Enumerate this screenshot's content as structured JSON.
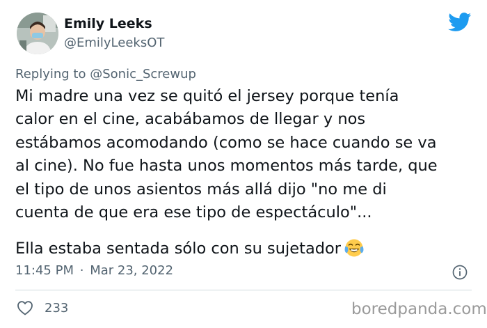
{
  "author": {
    "display_name": "Emily Leeks",
    "handle": "@EmilyLeeksOT",
    "avatar_icon": "profile-photo"
  },
  "reply": {
    "prefix": "Replying to",
    "mention": "@Sonic_Screwup"
  },
  "tweet": {
    "lines": [
      "Mi madre una vez se quitó el jersey porque tenía",
      "calor en el cine, acabábamos de llegar y nos",
      "estábamos acomodando (como se hace cuando se va",
      "al cine). No fue hasta unos momentos más tarde, que",
      "el tipo de unos asientos más allá dijo \"no me di",
      "cuenta de que era ese tipo de espectáculo\"..."
    ],
    "last_line": "Ella estaba sentada sólo con su sujetador",
    "emoji": "face-with-tears-of-joy"
  },
  "meta": {
    "time": "11:45 PM",
    "separator": "·",
    "date": "Mar 23, 2022"
  },
  "engagement": {
    "likes": "233"
  },
  "watermark": "boredpanda.com",
  "colors": {
    "twitter_blue": "#1d9bf0",
    "text": "#0f1419",
    "secondary": "#536471",
    "divider": "#cfd9de",
    "watermark": "#9a9a9a"
  },
  "icons": {
    "brand": "twitter-bird-icon",
    "info": "info-icon",
    "like": "heart-icon"
  }
}
